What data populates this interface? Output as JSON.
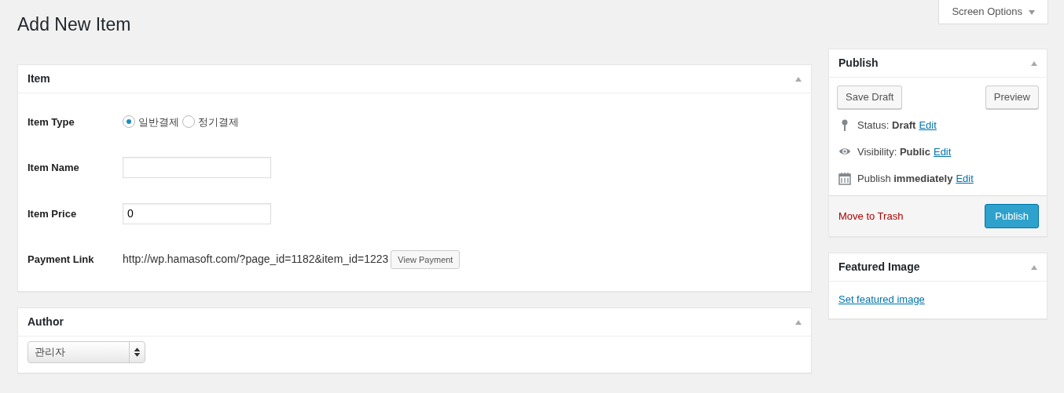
{
  "screen_options": {
    "label": "Screen Options"
  },
  "page_title": "Add New Item",
  "item_box": {
    "title": "Item",
    "fields": [
      {
        "kind": "radio",
        "label": "Item Type",
        "options": [
          {
            "label": "일반결제",
            "selected": true
          },
          {
            "label": "정기결제",
            "selected": false
          }
        ]
      },
      {
        "kind": "input",
        "label": "Item Name"
      },
      {
        "kind": "input",
        "label": "Item Price",
        "value": "0"
      },
      {
        "kind": "link",
        "label": "Payment Link",
        "text": "http://wp.hamasoft.com/?page_id=1182&item_id=1223",
        "button": "View Payment"
      }
    ]
  },
  "author_box": {
    "title": "Author",
    "select": {
      "value": "관리자"
    }
  },
  "publish_box": {
    "title": "Publish",
    "save_button": "Save Draft",
    "preview_button": "Preview",
    "misc": [
      {
        "kind": "status",
        "label": "Status:",
        "value": "Draft",
        "link": "Edit"
      },
      {
        "kind": "visibility",
        "label": "Visibility:",
        "value": "Public",
        "link": "Edit"
      },
      {
        "kind": "schedule",
        "label": "Publish",
        "value": "immediately",
        "link": "Edit"
      }
    ],
    "trash_link": "Move to Trash",
    "publish_button": "Publish"
  },
  "featured_box": {
    "title": "Featured Image",
    "link": "Set featured image"
  }
}
